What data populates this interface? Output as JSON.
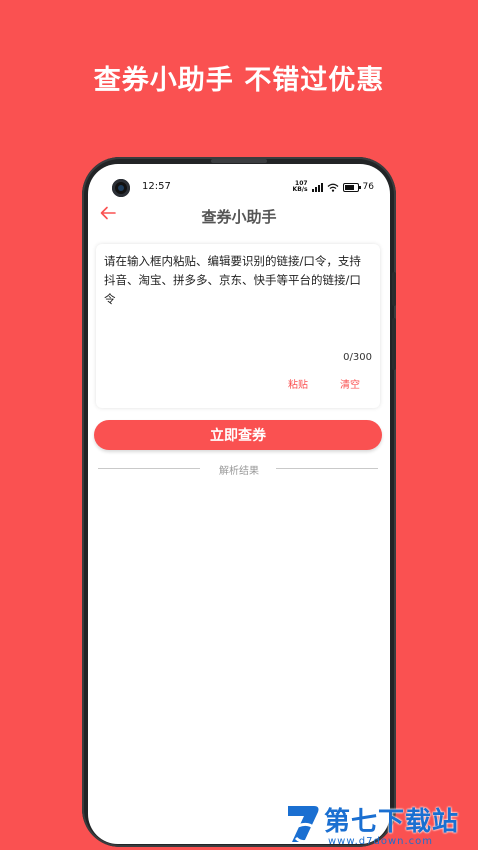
{
  "headline": "查券小助手 不错过优惠",
  "status_bar": {
    "time": "12:57",
    "net_speed_value": "107",
    "net_speed_unit": "KB/s",
    "battery": "76"
  },
  "navbar": {
    "back_icon": "back-arrow-icon",
    "title": "查券小助手"
  },
  "input_card": {
    "placeholder": "请在输入框内粘贴、编辑要识别的链接/口令，支持抖音、淘宝、拼多多、京东、快手等平台的链接/口令",
    "value": "",
    "counter": "0/300",
    "paste_label": "粘贴",
    "clear_label": "清空"
  },
  "query_button": "立即查券",
  "divider_label": "解析结果",
  "watermark": {
    "text": "第七下载站",
    "url": "www.d7down.com"
  },
  "colors": {
    "brand": "#fa5151",
    "background": "#ffffff",
    "watermark": "#1a6fd1"
  }
}
